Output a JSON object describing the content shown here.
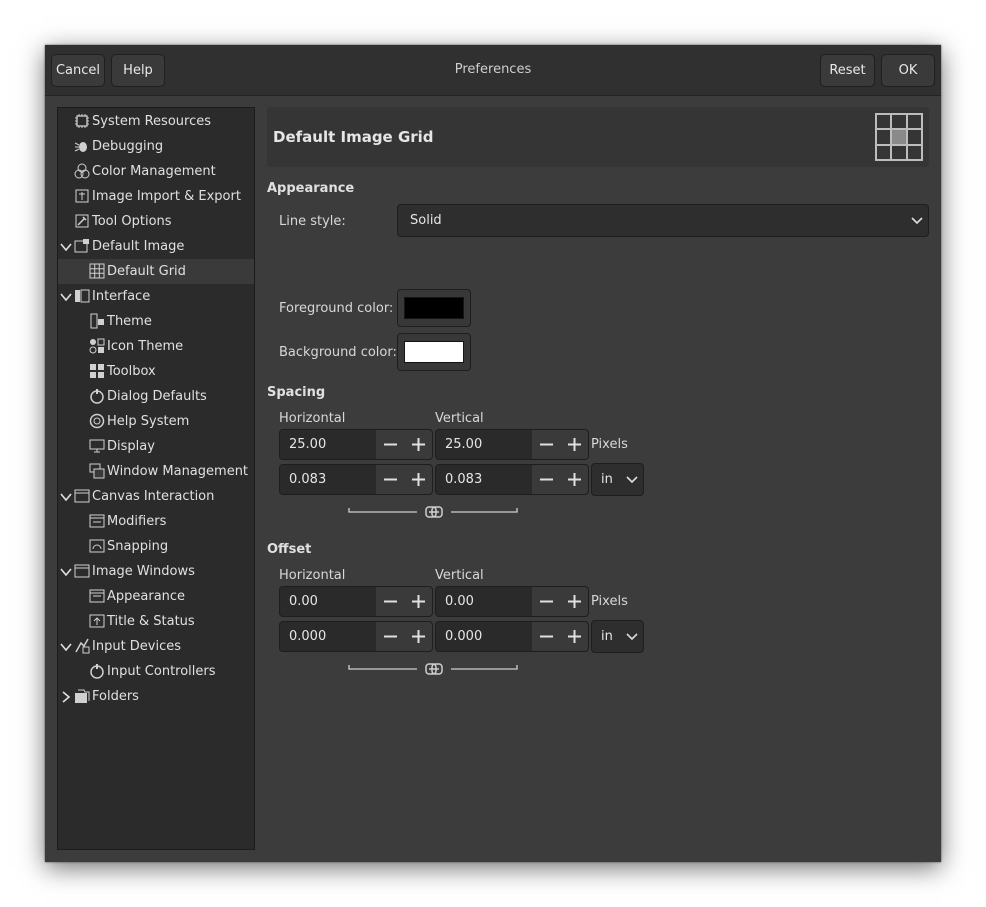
{
  "window": {
    "title": "Preferences",
    "cancel_label": "Cancel",
    "help_label": "Help",
    "reset_label": "Reset",
    "ok_label": "OK"
  },
  "sidebar": {
    "items": [
      {
        "label": "System Resources",
        "icon": "chip-icon",
        "level": 0,
        "arrow": "none"
      },
      {
        "label": "Debugging",
        "icon": "bug-icon",
        "level": 0,
        "arrow": "none"
      },
      {
        "label": "Color Management",
        "icon": "color-circles-icon",
        "level": 0,
        "arrow": "none"
      },
      {
        "label": "Image Import & Export",
        "icon": "import-export-icon",
        "level": 0,
        "arrow": "none"
      },
      {
        "label": "Tool Options",
        "icon": "tool-options-icon",
        "level": 0,
        "arrow": "none"
      },
      {
        "label": "Default Image",
        "icon": "default-image-icon",
        "level": 0,
        "arrow": "down"
      },
      {
        "label": "Default Grid",
        "icon": "grid-icon",
        "level": 1,
        "arrow": "none",
        "selected": true
      },
      {
        "label": "Interface",
        "icon": "interface-icon",
        "level": 0,
        "arrow": "down"
      },
      {
        "label": "Theme",
        "icon": "theme-icon",
        "level": 1,
        "arrow": "none"
      },
      {
        "label": "Icon Theme",
        "icon": "icon-theme-icon",
        "level": 1,
        "arrow": "none"
      },
      {
        "label": "Toolbox",
        "icon": "toolbox-icon",
        "level": 1,
        "arrow": "none"
      },
      {
        "label": "Dialog Defaults",
        "icon": "dialog-defaults-icon",
        "level": 1,
        "arrow": "none"
      },
      {
        "label": "Help System",
        "icon": "lifebuoy-icon",
        "level": 1,
        "arrow": "none"
      },
      {
        "label": "Display",
        "icon": "monitor-icon",
        "level": 1,
        "arrow": "none"
      },
      {
        "label": "Window Management",
        "icon": "windows-icon",
        "level": 1,
        "arrow": "none"
      },
      {
        "label": "Canvas Interaction",
        "icon": "canvas-icon",
        "level": 0,
        "arrow": "down"
      },
      {
        "label": "Modifiers",
        "icon": "modifiers-icon",
        "level": 1,
        "arrow": "none"
      },
      {
        "label": "Snapping",
        "icon": "snapping-icon",
        "level": 1,
        "arrow": "none"
      },
      {
        "label": "Image Windows",
        "icon": "image-window-icon",
        "level": 0,
        "arrow": "down"
      },
      {
        "label": "Appearance",
        "icon": "appearance-icon",
        "level": 1,
        "arrow": "none"
      },
      {
        "label": "Title & Status",
        "icon": "title-status-icon",
        "level": 1,
        "arrow": "none"
      },
      {
        "label": "Input Devices",
        "icon": "input-devices-icon",
        "level": 0,
        "arrow": "down"
      },
      {
        "label": "Input Controllers",
        "icon": "input-controllers-icon",
        "level": 1,
        "arrow": "none"
      },
      {
        "label": "Folders",
        "icon": "folders-icon",
        "level": 0,
        "arrow": "right"
      }
    ]
  },
  "page": {
    "title": "Default Image Grid",
    "header_icon": "grid-large-icon"
  },
  "appearance": {
    "section_title": "Appearance",
    "line_style_label": "Line style:",
    "line_style_value": "Solid",
    "fg_label": "Foreground color:",
    "fg_color": "#000000",
    "bg_label": "Background color:",
    "bg_color": "#ffffff"
  },
  "spacing": {
    "section_title": "Spacing",
    "horizontal_label": "Horizontal",
    "vertical_label": "Vertical",
    "h_pixels": "25.00",
    "v_pixels": "25.00",
    "pixels_unit": "Pixels",
    "h_in": "0.083",
    "v_in": "0.083",
    "unit": "in"
  },
  "offset": {
    "section_title": "Offset",
    "horizontal_label": "Horizontal",
    "vertical_label": "Vertical",
    "h_pixels": "0.00",
    "v_pixels": "0.00",
    "pixels_unit": "Pixels",
    "h_in": "0.000",
    "v_in": "0.000",
    "unit": "in"
  },
  "colors": {
    "window_bg": "#3c3c3c",
    "sidebar_bg": "#2b2b2b",
    "selected_bg": "#3a3a3a",
    "entry_bg": "#2a2a2a"
  }
}
